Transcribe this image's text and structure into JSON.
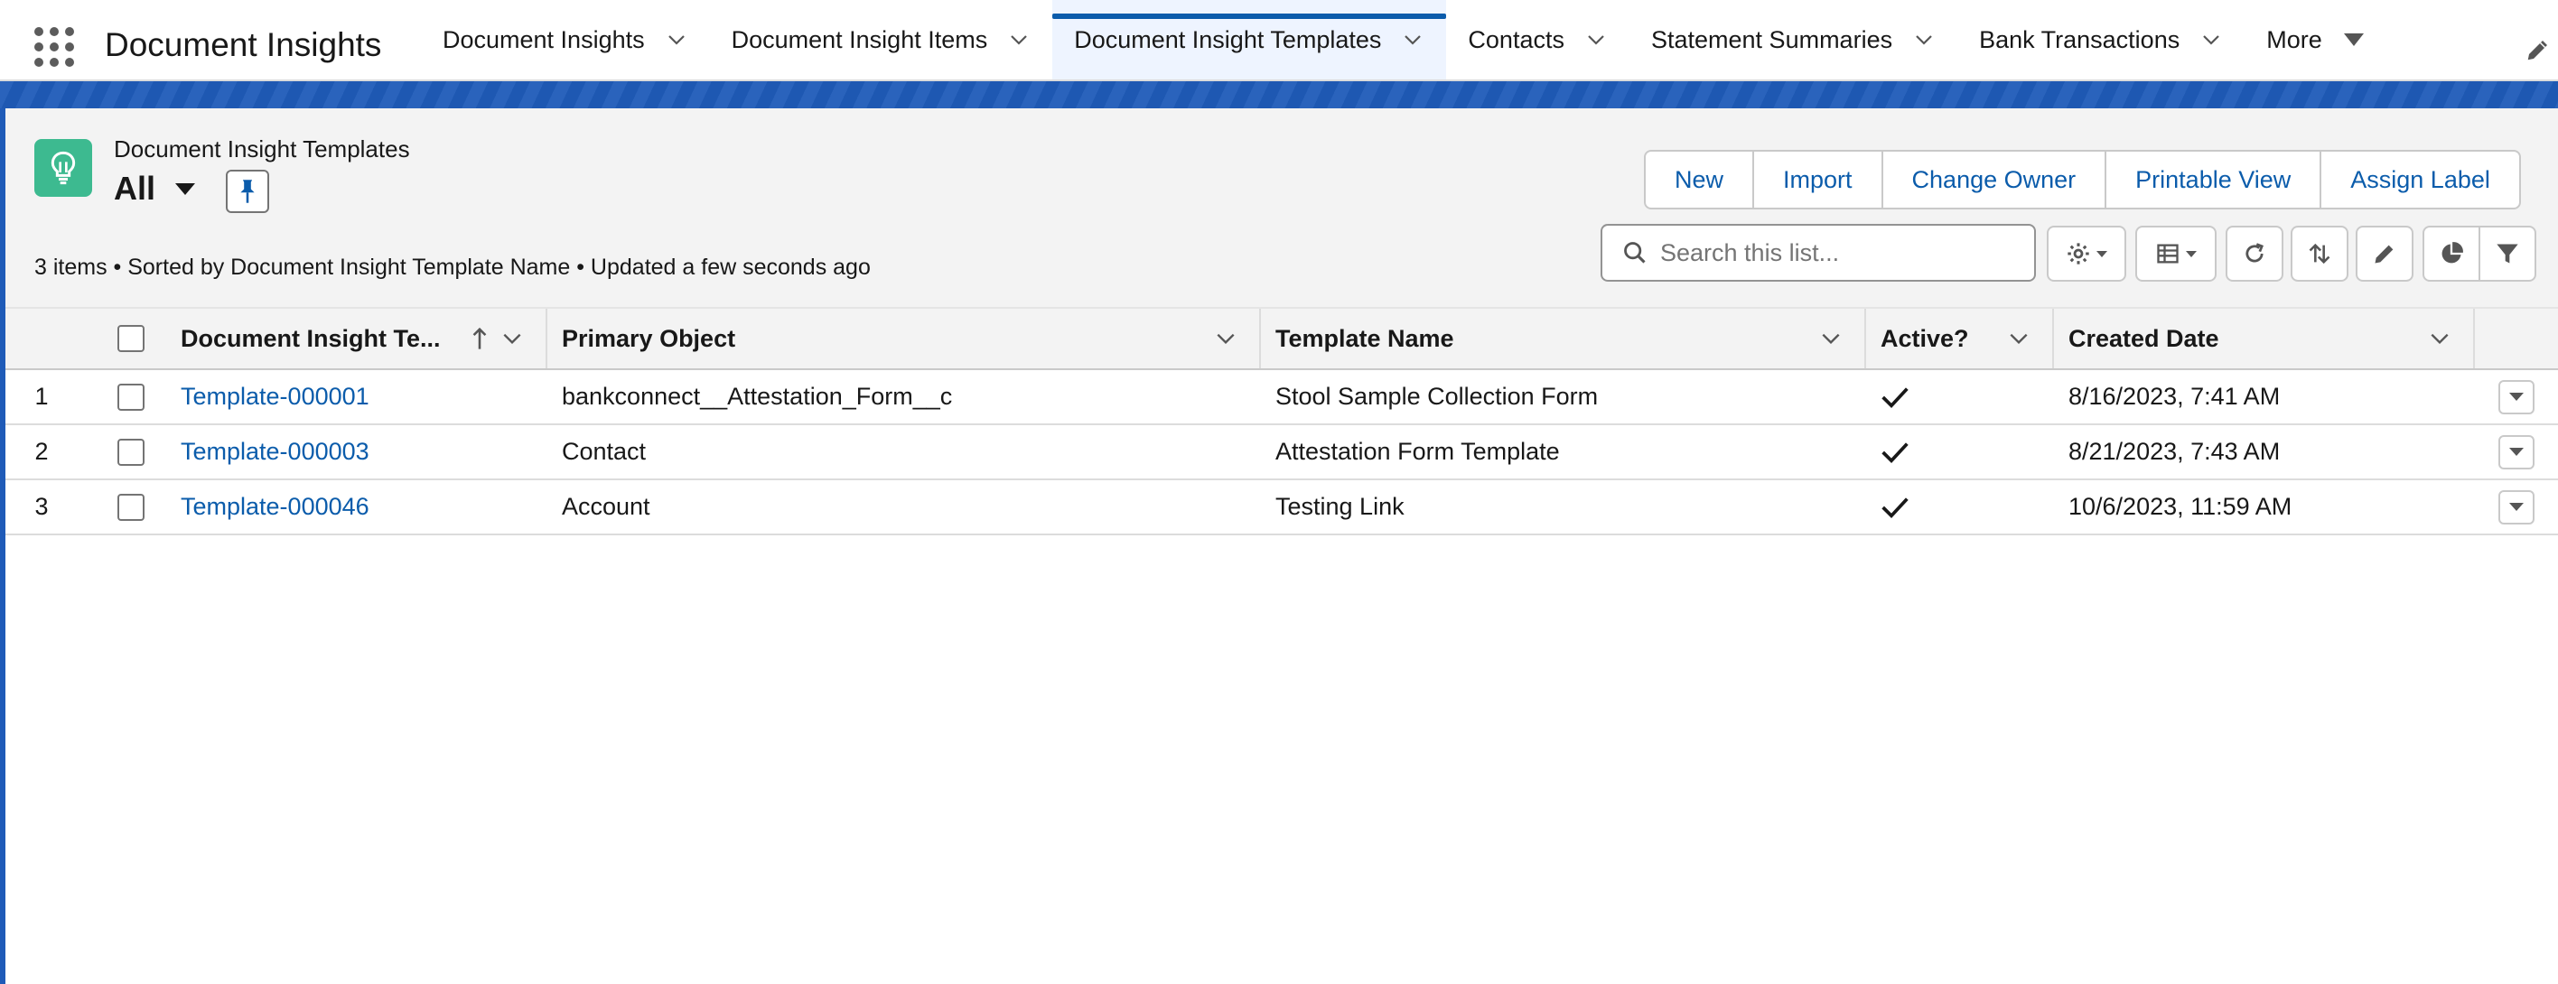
{
  "app": {
    "name": "Document Insights"
  },
  "nav": {
    "tabs": [
      {
        "label": "Document Insights",
        "active": false
      },
      {
        "label": "Document Insight Items",
        "active": false
      },
      {
        "label": "Document Insight Templates",
        "active": true
      },
      {
        "label": "Contacts",
        "active": false
      },
      {
        "label": "Statement Summaries",
        "active": false
      },
      {
        "label": "Bank Transactions",
        "active": false
      }
    ],
    "more_label": "More"
  },
  "list_view": {
    "object_title": "Document Insight Templates",
    "view_name": "All",
    "summary": "3 items • Sorted by Document Insight Template Name • Updated a few seconds ago",
    "buttons": {
      "new": "New",
      "import": "Import",
      "change_owner": "Change Owner",
      "printable_view": "Printable View",
      "assign_label": "Assign Label"
    },
    "search": {
      "placeholder": "Search this list...",
      "value": ""
    }
  },
  "table": {
    "columns": {
      "name": "Document Insight Te...",
      "primary_object": "Primary Object",
      "template_name": "Template Name",
      "active": "Active?",
      "created_date": "Created Date"
    },
    "sort": {
      "column": "name",
      "direction": "ascending"
    },
    "rows": [
      {
        "num": "1",
        "name": "Template-000001",
        "primary_object": "bankconnect__Attestation_Form__c",
        "template_name": "Stool Sample Collection Form",
        "active": true,
        "created_date": "8/16/2023, 7:41 AM"
      },
      {
        "num": "2",
        "name": "Template-000003",
        "primary_object": "Contact",
        "template_name": "Attestation Form Template",
        "active": true,
        "created_date": "8/21/2023, 7:43 AM"
      },
      {
        "num": "3",
        "name": "Template-000046",
        "primary_object": "Account",
        "template_name": "Testing Link",
        "active": true,
        "created_date": "10/6/2023, 11:59 AM"
      }
    ]
  },
  "colors": {
    "brand_blue": "#0b5cab",
    "band_blue": "#1f5bb8",
    "object_icon_green": "#3dba90"
  },
  "icons": {
    "app_launcher": "waffle-icon",
    "object": "lightbulb-icon",
    "pin": "pin-icon",
    "search": "search-icon",
    "settings": "gear-icon",
    "display_as": "table-icon",
    "refresh": "refresh-icon",
    "sort": "sort-icon",
    "inline_edit": "pencil-icon",
    "charts": "chart-icon",
    "filter": "filter-icon",
    "active_check": "check-icon"
  }
}
